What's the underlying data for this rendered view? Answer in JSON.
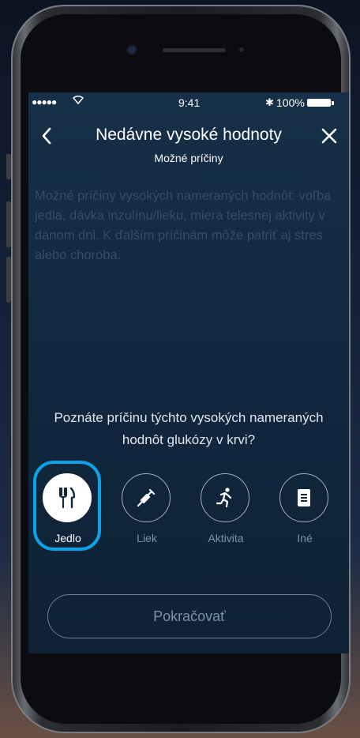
{
  "status_bar": {
    "signal": "●●●●●",
    "time": "9:41",
    "bluetooth": "✱",
    "battery_percent": "100%"
  },
  "header": {
    "back_icon": "chevron-left-icon",
    "close_icon": "close-icon",
    "title": "Nedávne vysoké hodnoty",
    "subtitle": "Možné príčiny"
  },
  "description": "Možné príčiny vysokých nameraných hodnôt: voľba jedla, dávka inzulínu/lieku, miera telesnej aktivity v danom dni. K ďalším príčinám môže patriť aj stres alebo choroba.",
  "question": "Poznáte príčinu týchto vysokých nameraných hodnôt glukózy v krvi?",
  "options": [
    {
      "label": "Jedlo",
      "icon": "fork-knife-icon",
      "selected": true
    },
    {
      "label": "Liek",
      "icon": "syringe-icon",
      "selected": false
    },
    {
      "label": "Aktivita",
      "icon": "running-icon",
      "selected": false
    },
    {
      "label": "Iné",
      "icon": "document-icon",
      "selected": false
    }
  ],
  "continue_button": "Pokračovať",
  "colors": {
    "selection_ring": "#0aa3e8",
    "screen_background": "#12283e"
  }
}
